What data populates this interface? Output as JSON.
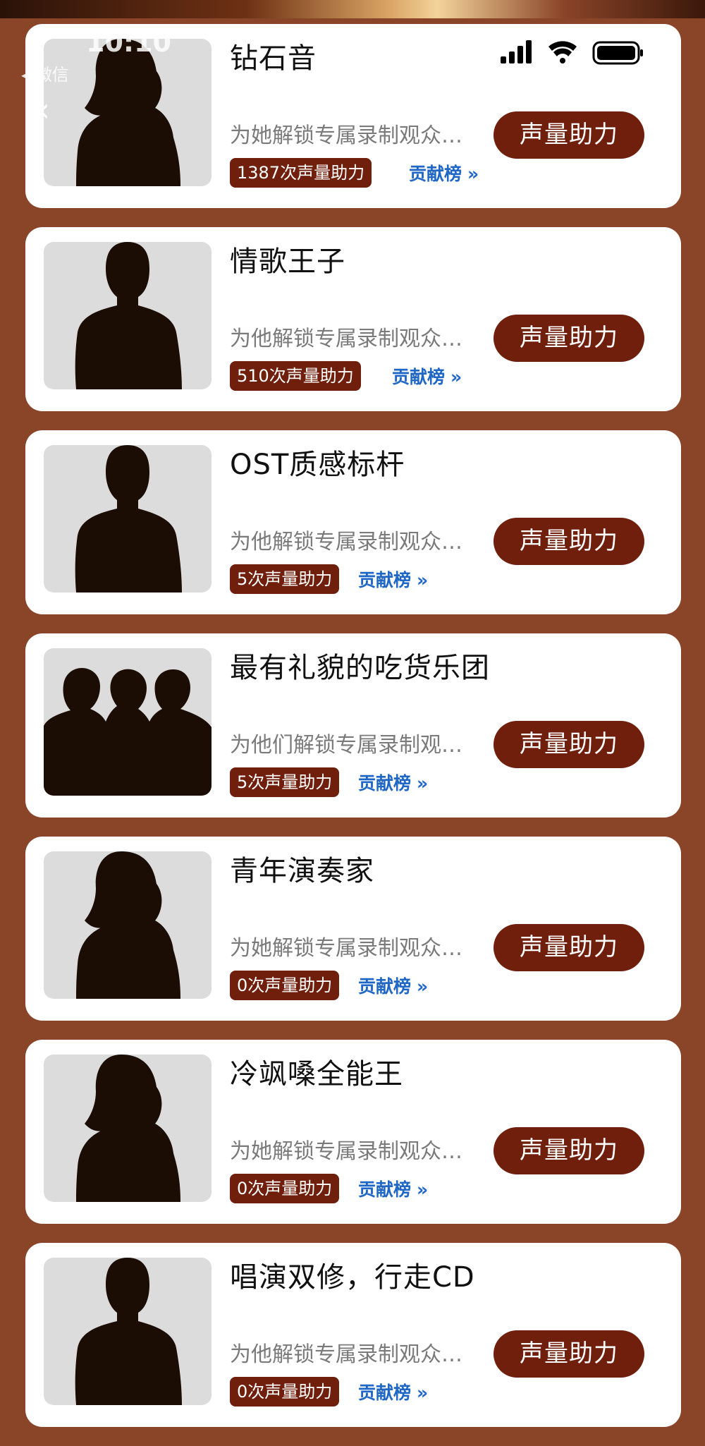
{
  "status_bar": {
    "time": "10:10",
    "back_app": "微信"
  },
  "cards": [
    {
      "title": "钻石音",
      "desc": "为她解锁专属录制观众席位",
      "count": "1387次声量助力",
      "rank": "贡献榜",
      "button": "声量助力",
      "avatar": "female"
    },
    {
      "title": "情歌王子",
      "desc": "为他解锁专属录制观众席位",
      "count": "510次声量助力",
      "rank": "贡献榜",
      "button": "声量助力",
      "avatar": "male"
    },
    {
      "title": "OST质感标杆",
      "desc": "为他解锁专属录制观众席位",
      "count": "5次声量助力",
      "rank": "贡献榜",
      "button": "声量助力",
      "avatar": "male"
    },
    {
      "title": "最有礼貌的吃货乐团",
      "desc": "为他们解锁专属录制观众席位",
      "count": "5次声量助力",
      "rank": "贡献榜",
      "button": "声量助力",
      "avatar": "group"
    },
    {
      "title": "青年演奏家",
      "desc": "为她解锁专属录制观众席位",
      "count": "0次声量助力",
      "rank": "贡献榜",
      "button": "声量助力",
      "avatar": "female"
    },
    {
      "title": "冷飒嗓全能王",
      "desc": "为她解锁专属录制观众席位",
      "count": "0次声量助力",
      "rank": "贡献榜",
      "button": "声量助力",
      "avatar": "female"
    },
    {
      "title": "唱演双修，行走CD",
      "desc": "为他解锁专属录制观众席位",
      "count": "0次声量助力",
      "rank": "贡献榜",
      "button": "声量助力",
      "avatar": "male"
    }
  ],
  "colors": {
    "background": "#8a4428",
    "accent": "#6f1f0b",
    "link": "#1f67c7"
  }
}
